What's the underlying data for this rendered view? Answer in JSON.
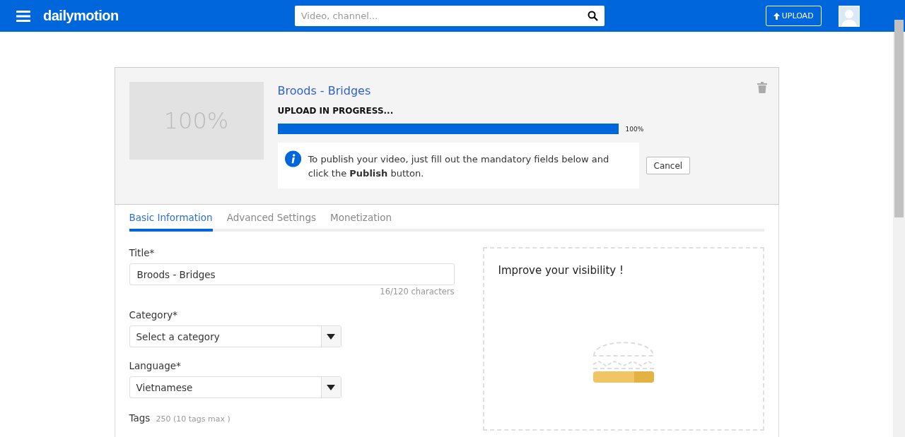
{
  "header": {
    "logo": "dailymotion",
    "search": {
      "placeholder": "Video, channel..."
    },
    "upload_button": "UPLOAD"
  },
  "upload": {
    "thumbnail_text": "100%",
    "video_title": "Broods - Bridges",
    "status": "UPLOAD IN PROGRESS...",
    "level": 1,
    "percent": "100%",
    "info": "To publish your video, just fill out the mandatory fields below and click the **Publish** button.",
    "cancel_button": "Cancel"
  },
  "tabs": [
    {
      "label": "Basic Information",
      "selected": true
    },
    {
      "label": "Advanced Settings",
      "selected": false
    },
    {
      "label": "Monetization",
      "selected": false
    }
  ],
  "form": {
    "title": {
      "label": "Title*",
      "value": "Broods - Bridges",
      "counter": "16/120 characters"
    },
    "category": {
      "label": "Category*",
      "value": "Select a category"
    },
    "language": {
      "label": "Language*",
      "value": "Vietnamese"
    },
    "tags": {
      "label": "Tags",
      "hint": "250 (10 tags max )"
    }
  },
  "visibility": {
    "title": "Improve your visibility !"
  }
}
